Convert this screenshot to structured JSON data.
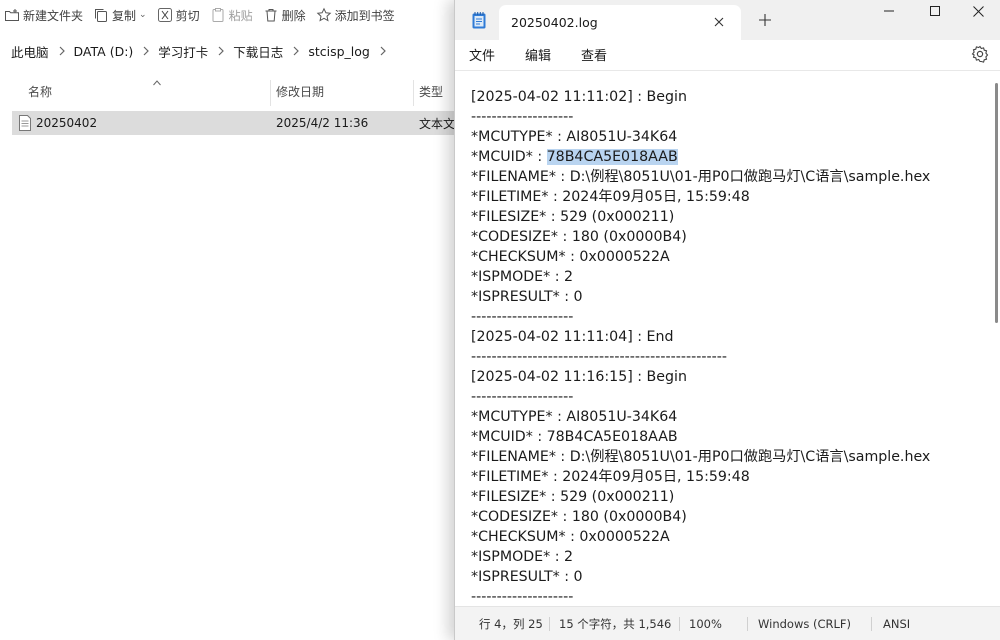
{
  "explorer": {
    "toolbar": {
      "new_folder": "新建文件夹",
      "copy": "复制",
      "cut": "剪切",
      "paste": "粘贴",
      "delete": "删除",
      "add_bookmark": "添加到书签"
    },
    "breadcrumb": [
      "此电脑",
      "DATA (D:)",
      "学习打卡",
      "下载日志",
      "stcisp_log"
    ],
    "columns": {
      "name": "名称",
      "modified": "修改日期",
      "type": "类型"
    },
    "files": [
      {
        "name": "20250402",
        "modified": "2025/4/2 11:36",
        "type": "文本文"
      }
    ]
  },
  "notepad": {
    "tab_title": "20250402.log",
    "menu": {
      "file": "文件",
      "edit": "编辑",
      "view": "查看"
    },
    "lines": {
      "l1": "[2025-04-02 11:11:02] : Begin",
      "l2": "--------------------",
      "l3": "*MCUTYPE* : AI8051U-34K64",
      "l4_prefix": "*MCUID* : ",
      "l4_selected": "78B4CA5E018AAB",
      "l5": "*FILENAME* : D:\\例程\\8051U\\01-用P0口做跑马灯\\C语言\\sample.hex",
      "l6": "*FILETIME* : 2024年09月05日, 15:59:48",
      "l7": "*FILESIZE* : 529 (0x000211)",
      "l8": "*CODESIZE* : 180 (0x0000B4)",
      "l9": "*CHECKSUM* : 0x0000522A",
      "l10": "*ISPMODE* : 2",
      "l11": "*ISPRESULT* : 0",
      "l12": "--------------------",
      "l13": "[2025-04-02 11:11:04] : End",
      "l14": "--------------------------------------------------",
      "l15": "[2025-04-02 11:16:15] : Begin",
      "l16": "--------------------",
      "l17": "*MCUTYPE* : AI8051U-34K64",
      "l18": "*MCUID* : 78B4CA5E018AAB",
      "l19": "*FILENAME* : D:\\例程\\8051U\\01-用P0口做跑马灯\\C语言\\sample.hex",
      "l20": "*FILETIME* : 2024年09月05日, 15:59:48",
      "l21": "*FILESIZE* : 529 (0x000211)",
      "l22": "*CODESIZE* : 180 (0x0000B4)",
      "l23": "*CHECKSUM* : 0x0000522A",
      "l24": "*ISPMODE* : 2",
      "l25": "*ISPRESULT* : 0",
      "l26": "--------------------"
    },
    "status": {
      "position": "行 4，列 25",
      "selection": "15 个字符，共 1,546",
      "zoom": "100%",
      "line_ending": "Windows (CRLF)",
      "encoding": "ANSI"
    },
    "colors": {
      "selection": "#b9d4f0",
      "titlebar": "#f0f0f0"
    }
  }
}
